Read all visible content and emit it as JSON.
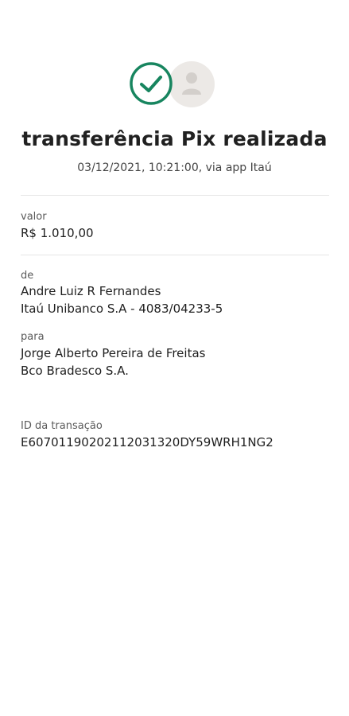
{
  "header": {
    "status_icon": "check-circle-icon",
    "avatar_icon": "user-icon",
    "accent_color": "#17855f",
    "title": "transferência Pix realizada",
    "subtitle": "03/12/2021,  10:21:00, via app Itaú"
  },
  "valor": {
    "label": "valor",
    "amount": "R$ 1.010,00"
  },
  "de": {
    "label": "de",
    "name": "Andre Luiz R Fernandes",
    "bank": "Itaú Unibanco S.A - 4083/04233-5"
  },
  "para": {
    "label": "para",
    "name": "Jorge Alberto Pereira de Freitas",
    "bank": "Bco Bradesco S.A."
  },
  "transacao": {
    "label": "ID da transação",
    "id": "E60701190202112031320DY59WRH1NG2"
  }
}
